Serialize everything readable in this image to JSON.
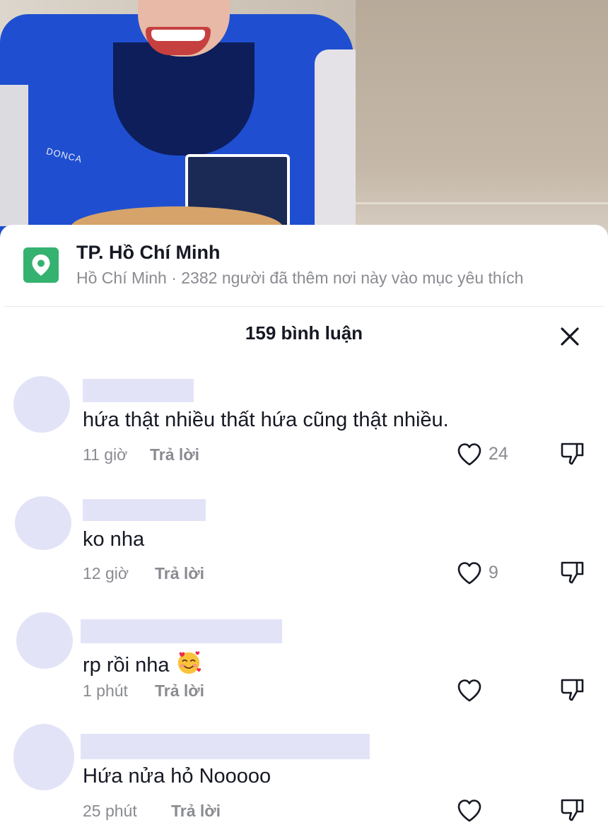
{
  "video": {
    "jacket_text": "DONCA"
  },
  "location": {
    "icon": "map-pin-icon",
    "title": "TP. Hồ Chí Minh",
    "subtitle": "Hồ Chí Minh · 2382 người đã thêm nơi này vào mục yêu thích"
  },
  "comments_header": {
    "count_label": "159 bình luận",
    "close_icon": "close-icon"
  },
  "comments": [
    {
      "text": "hứa thật nhiều thất hứa cũng thật nhiều.",
      "time": "11 giờ",
      "reply": "Trả lời",
      "likes": "24"
    },
    {
      "text": "ko nha",
      "time": "12 giờ",
      "reply": "Trả lời",
      "likes": "9"
    },
    {
      "text": "rp rồi nha",
      "emoji": "smiling-face-with-hearts",
      "time": "1 phút",
      "reply": "Trả lời",
      "likes": ""
    },
    {
      "text": "Hứa nửa hỏ Nooooo",
      "time": "25 phút",
      "reply": "Trả lời",
      "likes": ""
    }
  ],
  "colors": {
    "accent_green": "#35b26f",
    "placeholder_lavender": "#e3e3f8",
    "text_primary": "#161823",
    "text_secondary": "#8a8b91"
  }
}
